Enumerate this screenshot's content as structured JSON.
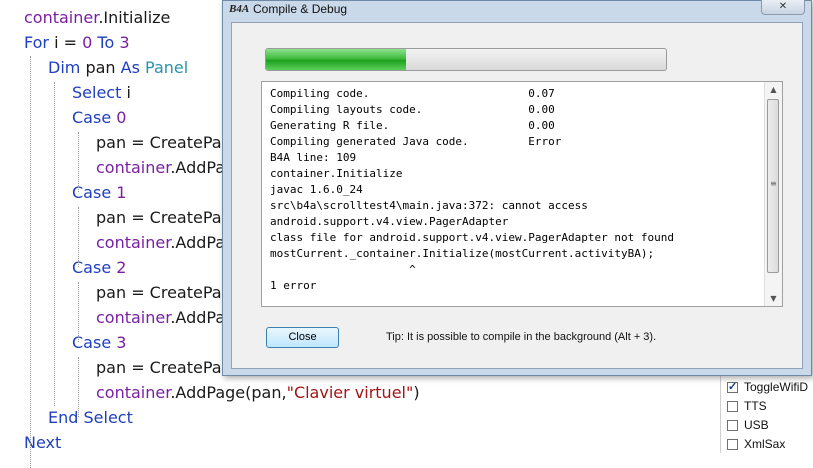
{
  "editor": {
    "lines": [
      {
        "tokens": [
          {
            "t": "container",
            "c": "obj"
          },
          {
            "t": ".Initialize",
            "c": "plain"
          }
        ]
      },
      {
        "tokens": [
          {
            "t": "For",
            "c": "kw"
          },
          {
            "t": " i = ",
            "c": "plain"
          },
          {
            "t": "0",
            "c": "num"
          },
          {
            "t": " ",
            "c": "plain"
          },
          {
            "t": "To",
            "c": "kw"
          },
          {
            "t": " ",
            "c": "plain"
          },
          {
            "t": "3",
            "c": "num"
          }
        ]
      },
      {
        "tokens": [
          {
            "t": "Dim",
            "c": "kw"
          },
          {
            "t": " pan ",
            "c": "plain"
          },
          {
            "t": "As",
            "c": "kw"
          },
          {
            "t": " ",
            "c": "plain"
          },
          {
            "t": "Panel",
            "c": "typ"
          }
        ]
      },
      {
        "tokens": [
          {
            "t": "Select",
            "c": "kw"
          },
          {
            "t": " i",
            "c": "plain"
          }
        ]
      },
      {
        "tokens": [
          {
            "t": "Case",
            "c": "kw"
          },
          {
            "t": " ",
            "c": "plain"
          },
          {
            "t": "0",
            "c": "num"
          }
        ]
      },
      {
        "tokens": [
          {
            "t": "pan = CreatePan",
            "c": "plain"
          }
        ]
      },
      {
        "tokens": [
          {
            "t": "container",
            "c": "obj"
          },
          {
            "t": ".AddPa",
            "c": "plain"
          }
        ]
      },
      {
        "tokens": [
          {
            "t": "Case",
            "c": "kw"
          },
          {
            "t": " ",
            "c": "plain"
          },
          {
            "t": "1",
            "c": "num"
          }
        ]
      },
      {
        "tokens": [
          {
            "t": "pan = CreatePan",
            "c": "plain"
          }
        ]
      },
      {
        "tokens": [
          {
            "t": "container",
            "c": "obj"
          },
          {
            "t": ".AddPa",
            "c": "plain"
          }
        ]
      },
      {
        "tokens": [
          {
            "t": "Case",
            "c": "kw"
          },
          {
            "t": " ",
            "c": "plain"
          },
          {
            "t": "2",
            "c": "num"
          }
        ]
      },
      {
        "tokens": [
          {
            "t": "pan = CreatePan",
            "c": "plain"
          }
        ]
      },
      {
        "tokens": [
          {
            "t": "container",
            "c": "obj"
          },
          {
            "t": ".AddPa",
            "c": "plain"
          }
        ]
      },
      {
        "tokens": [
          {
            "t": "Case",
            "c": "kw"
          },
          {
            "t": " ",
            "c": "plain"
          },
          {
            "t": "3",
            "c": "num"
          }
        ]
      },
      {
        "tokens": [
          {
            "t": "pan = CreatePan",
            "c": "plain"
          }
        ]
      },
      {
        "tokens": [
          {
            "t": "container",
            "c": "obj"
          },
          {
            "t": ".AddPage(pan,",
            "c": "plain"
          },
          {
            "t": "\"Clavier virtuel\"",
            "c": "str"
          },
          {
            "t": ")",
            "c": "plain"
          }
        ]
      },
      {
        "tokens": [
          {
            "t": "End Select",
            "c": "kw"
          }
        ]
      },
      {
        "tokens": [
          {
            "t": "Next",
            "c": "kw"
          }
        ]
      }
    ]
  },
  "libraries": [
    {
      "label": "ToggleWifiD",
      "checked": true
    },
    {
      "label": "TTS",
      "checked": false
    },
    {
      "label": "USB",
      "checked": false
    },
    {
      "label": "XmlSax",
      "checked": false
    }
  ],
  "dialog": {
    "app_icon_text": "B4A",
    "title": "Compile & Debug",
    "progress_fraction": 0.35,
    "output_lines": [
      "Compiling code.                        0.07",
      "Compiling layouts code.                0.00",
      "Generating R file.                     0.00",
      "Compiling generated Java code.         Error",
      "B4A line: 109",
      "container.Initialize",
      "javac 1.6.0_24",
      "src\\b4a\\scrolltest4\\main.java:372: cannot access",
      "android.support.v4.view.PagerAdapter",
      "class file for android.support.v4.view.PagerAdapter not found",
      "mostCurrent._container.Initialize(mostCurrent.activityBA);",
      "                     ^",
      "1 error"
    ],
    "close_label": "Close",
    "tip": "Tip: It is possible to compile in the background (Alt + 3)."
  }
}
